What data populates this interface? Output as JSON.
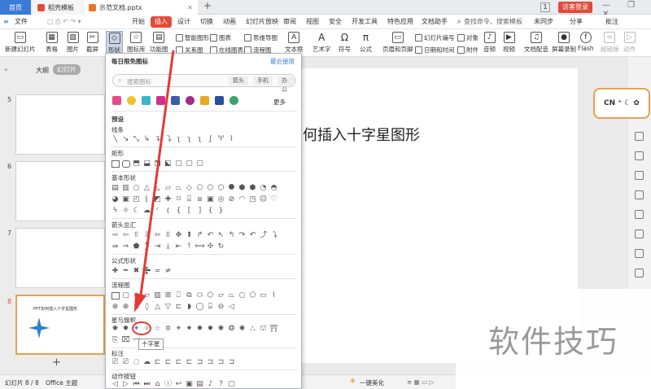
{
  "titlebar": {
    "tab_home": "首页",
    "tab_template": "稻壳模板",
    "tab_doc": "示范文档.pptx",
    "add": "+",
    "page_num": "1",
    "login": "访客登录",
    "winctl": "— ❐ ✕"
  },
  "menus": [
    "文件",
    "开始",
    "插入",
    "设计",
    "切换",
    "动画",
    "幻灯片放映",
    "审阅",
    "视图",
    "安全",
    "开发工具",
    "特色应用",
    "文档助手"
  ],
  "menu_search": "查找命令、搜索模板",
  "menu_right": [
    "未同步",
    "分享",
    "批注"
  ],
  "toolbar": {
    "new_slide": "新建幻灯片",
    "table": "表格",
    "picture": "图片",
    "screenshot": "截屏",
    "shape": "形状",
    "icon_lib": "图标库",
    "func_chart": "功能图",
    "smart_shape": "智能图形",
    "chart": "图表",
    "mind_map": "思维导图",
    "relation": "关系图",
    "online_chart": "在线图表",
    "flow_chart": "流程图",
    "textbox": "文本框",
    "art_text": "艺术字",
    "symbol": "符号",
    "formula": "公式",
    "header_footer": "页眉和页脚",
    "slide_num": "幻灯片编号",
    "object": "对象",
    "datetime": "日期和时间",
    "attachment": "附件",
    "audio": "音频",
    "video": "视频",
    "doc_dub": "文档配音",
    "screen_rec": "屏幕录制",
    "flash": "Flash",
    "hyperlink": "超链接",
    "action": "动作"
  },
  "leftpane": {
    "tab_outline": "大纲",
    "tab_slides": "幻灯片",
    "slides": [
      "5",
      "6",
      "7",
      "8"
    ],
    "selected_caption": "PPT如何插入十字星图形",
    "add": "+"
  },
  "slide": {
    "title": "何插入十字星图形"
  },
  "popup": {
    "recent_title": "每日限免图标",
    "recent_link": "最近使用",
    "search_placeholder": "搜索图标",
    "chips": [
      "箭头",
      "手机",
      "办公"
    ],
    "more": "更多",
    "preset": "预设",
    "sections": [
      "线条",
      "矩形",
      "基本形状",
      "箭头总汇",
      "公式形状",
      "流程图",
      "星与旗帜",
      "标注",
      "动作按钮"
    ],
    "tooltip": "十字星"
  },
  "statusbar": {
    "slide_info": "幻灯片 8 / 8",
    "theme": "Office 主题",
    "doc_assist": "文档助",
    "beautify": "一键美化",
    "zoom": "55%"
  },
  "watermark": "软件技巧",
  "colors": {
    "accent": "#e04b3a",
    "home_tab": "#3a7bd5",
    "annotation": "#e53935",
    "star": "#2f7fd1"
  }
}
